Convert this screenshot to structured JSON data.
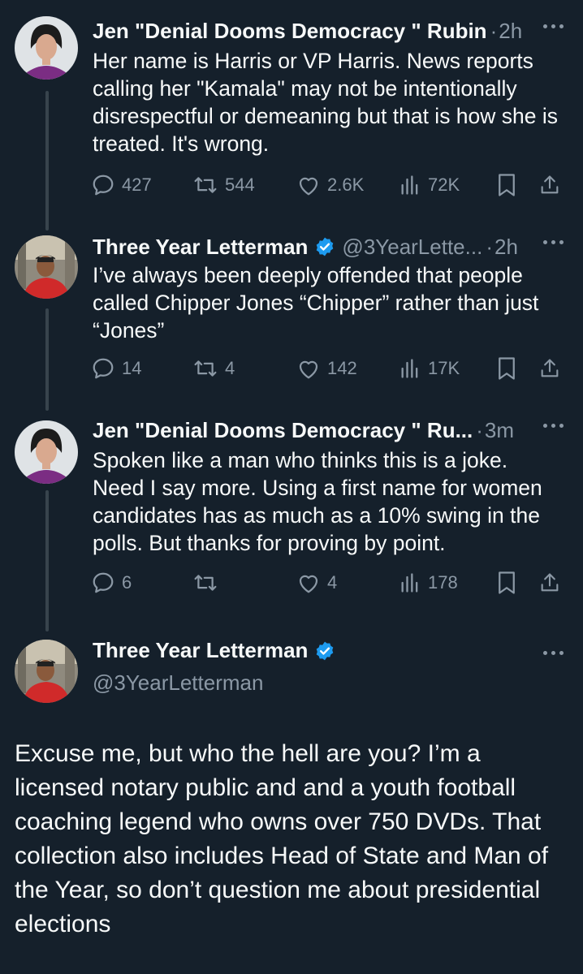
{
  "colors": {
    "background": "#15202b",
    "text": "#f7f9f9",
    "muted": "#8b98a5",
    "verified": "#1d9bf0",
    "thread_line": "#38444d"
  },
  "tweets": [
    {
      "author": "Jen \"Denial Dooms Democracy \" Rubin",
      "handle": "",
      "dot": "·",
      "time": "2h",
      "text": "Her name is Harris or VP Harris. News reports calling her \"Kamala\" may not be intentionally disrespectful or demeaning but that is how she is treated. It's wrong.",
      "replies": "427",
      "reposts": "544",
      "likes": "2.6K",
      "views": "72K"
    },
    {
      "author": "Three Year Letterman",
      "verified": true,
      "handle": "@3YearLette...",
      "dot": "·",
      "time": "2h",
      "text": "I’ve always been deeply offended that people called Chipper Jones “Chipper” rather than just “Jones”",
      "replies": "14",
      "reposts": "4",
      "likes": "142",
      "views": "17K"
    },
    {
      "author": "Jen \"Denial Dooms Democracy \" Ru...",
      "handle": "",
      "dot": "·",
      "time": "3m",
      "text": "Spoken like a man who thinks this is a joke. Need I say more. Using a first name for women candidates has as much as a 10% swing in the polls. But thanks for proving by point.",
      "replies": "6",
      "reposts": "",
      "likes": "4",
      "views": "178"
    }
  ],
  "main_tweet": {
    "author": "Three Year Letterman",
    "verified": true,
    "handle": "@3YearLetterman",
    "text": "Excuse me, but who the hell are you? I’m a licensed notary public and and a youth football coaching legend who owns over 750 DVDs. That collection also includes Head of State and Man of the Year, so don’t question me about presidential elections"
  },
  "icons": [
    "reply-icon",
    "repost-icon",
    "like-icon",
    "views-icon",
    "bookmark-icon",
    "share-icon",
    "more-icon",
    "verified-icon"
  ]
}
